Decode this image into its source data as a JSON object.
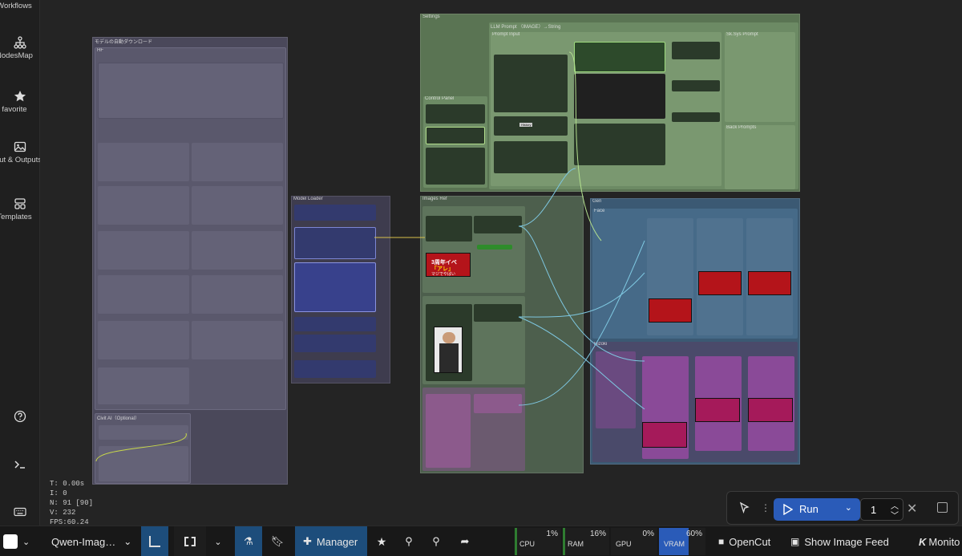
{
  "sidebar": {
    "items": [
      {
        "label": "Workflows",
        "icon": "workflows-icon"
      },
      {
        "label": "NodesMap",
        "icon": "nodesmap-icon"
      },
      {
        "label": "favorite",
        "icon": "star-icon"
      },
      {
        "label": "Input & Outputs",
        "icon": "image-icon"
      },
      {
        "label": "Templates",
        "icon": "templates-icon"
      }
    ],
    "help_icon": "help-icon",
    "terminal_icon": "terminal-icon",
    "keyboard_icon": "keyboard-icon"
  },
  "groups": {
    "download": "モデルの自動ダウンロード",
    "hf": "HF",
    "civitai": "Civit AI（Optional）",
    "settings": "Settings",
    "llm_prompt": "LLM Prompt （IMAGE）→String",
    "prompt_input": "Prompt Input",
    "sd_sys_prompt": "Sk.Sys Prompt",
    "back_prompts": "Back Prompts",
    "control_panel": "Control Panel",
    "model_loader": "Model Loader",
    "images_ref": "Images Ref",
    "gen": "Gen",
    "face": "Face",
    "hizoki": "Hizoki",
    "history_button": "History"
  },
  "thumb": {
    "banner_line1": "3周年イベ",
    "banner_line2": "「アレ」",
    "banner_line3": "マジでやばい"
  },
  "stats": {
    "time": "T: 0.00s",
    "iterations": "I: 0",
    "nodes": "N: 91 [90]",
    "vertices": "V: 232",
    "fps": "FPS:60.24"
  },
  "run_panel": {
    "run_label": "Run",
    "queue_count": "1"
  },
  "bottom_bar": {
    "workflow_name": "Qwen-Imag…",
    "manager_label": "Manager",
    "resources": [
      {
        "name": "CPU",
        "value": "1%"
      },
      {
        "name": "RAM",
        "value": "16%"
      },
      {
        "name": "GPU",
        "value": "0%"
      },
      {
        "name": "VRAM",
        "value": "60%"
      }
    ],
    "opencut_label": "OpenCut",
    "image_feed_label": "Show Image Feed",
    "monitor_label": "Monito"
  },
  "colors": {
    "accent": "#2a5bb8",
    "settings_group": "#5d7a57",
    "images_ref_group": "#4f6150",
    "gen_group": "#3c5b75",
    "hizoki_group": "#5a3f66",
    "model_loader_group": "#3e3c4c",
    "download_group": "#4c4a5c"
  }
}
